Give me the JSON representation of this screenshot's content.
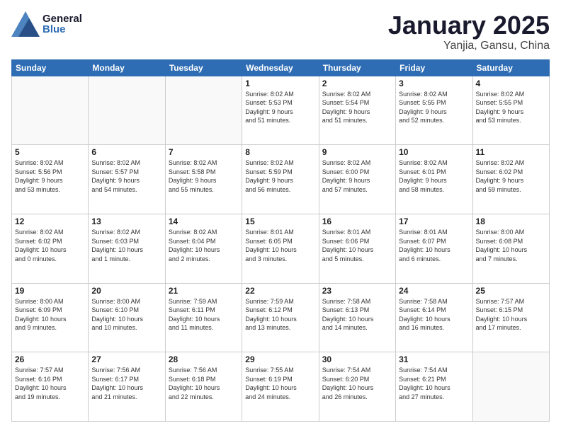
{
  "header": {
    "logo_general": "General",
    "logo_blue": "Blue",
    "title": "January 2025",
    "subtitle": "Yanjia, Gansu, China"
  },
  "days_of_week": [
    "Sunday",
    "Monday",
    "Tuesday",
    "Wednesday",
    "Thursday",
    "Friday",
    "Saturday"
  ],
  "weeks": [
    [
      {
        "day": "",
        "info": ""
      },
      {
        "day": "",
        "info": ""
      },
      {
        "day": "",
        "info": ""
      },
      {
        "day": "1",
        "info": "Sunrise: 8:02 AM\nSunset: 5:53 PM\nDaylight: 9 hours\nand 51 minutes."
      },
      {
        "day": "2",
        "info": "Sunrise: 8:02 AM\nSunset: 5:54 PM\nDaylight: 9 hours\nand 51 minutes."
      },
      {
        "day": "3",
        "info": "Sunrise: 8:02 AM\nSunset: 5:55 PM\nDaylight: 9 hours\nand 52 minutes."
      },
      {
        "day": "4",
        "info": "Sunrise: 8:02 AM\nSunset: 5:55 PM\nDaylight: 9 hours\nand 53 minutes."
      }
    ],
    [
      {
        "day": "5",
        "info": "Sunrise: 8:02 AM\nSunset: 5:56 PM\nDaylight: 9 hours\nand 53 minutes."
      },
      {
        "day": "6",
        "info": "Sunrise: 8:02 AM\nSunset: 5:57 PM\nDaylight: 9 hours\nand 54 minutes."
      },
      {
        "day": "7",
        "info": "Sunrise: 8:02 AM\nSunset: 5:58 PM\nDaylight: 9 hours\nand 55 minutes."
      },
      {
        "day": "8",
        "info": "Sunrise: 8:02 AM\nSunset: 5:59 PM\nDaylight: 9 hours\nand 56 minutes."
      },
      {
        "day": "9",
        "info": "Sunrise: 8:02 AM\nSunset: 6:00 PM\nDaylight: 9 hours\nand 57 minutes."
      },
      {
        "day": "10",
        "info": "Sunrise: 8:02 AM\nSunset: 6:01 PM\nDaylight: 9 hours\nand 58 minutes."
      },
      {
        "day": "11",
        "info": "Sunrise: 8:02 AM\nSunset: 6:02 PM\nDaylight: 9 hours\nand 59 minutes."
      }
    ],
    [
      {
        "day": "12",
        "info": "Sunrise: 8:02 AM\nSunset: 6:02 PM\nDaylight: 10 hours\nand 0 minutes."
      },
      {
        "day": "13",
        "info": "Sunrise: 8:02 AM\nSunset: 6:03 PM\nDaylight: 10 hours\nand 1 minute."
      },
      {
        "day": "14",
        "info": "Sunrise: 8:02 AM\nSunset: 6:04 PM\nDaylight: 10 hours\nand 2 minutes."
      },
      {
        "day": "15",
        "info": "Sunrise: 8:01 AM\nSunset: 6:05 PM\nDaylight: 10 hours\nand 3 minutes."
      },
      {
        "day": "16",
        "info": "Sunrise: 8:01 AM\nSunset: 6:06 PM\nDaylight: 10 hours\nand 5 minutes."
      },
      {
        "day": "17",
        "info": "Sunrise: 8:01 AM\nSunset: 6:07 PM\nDaylight: 10 hours\nand 6 minutes."
      },
      {
        "day": "18",
        "info": "Sunrise: 8:00 AM\nSunset: 6:08 PM\nDaylight: 10 hours\nand 7 minutes."
      }
    ],
    [
      {
        "day": "19",
        "info": "Sunrise: 8:00 AM\nSunset: 6:09 PM\nDaylight: 10 hours\nand 9 minutes."
      },
      {
        "day": "20",
        "info": "Sunrise: 8:00 AM\nSunset: 6:10 PM\nDaylight: 10 hours\nand 10 minutes."
      },
      {
        "day": "21",
        "info": "Sunrise: 7:59 AM\nSunset: 6:11 PM\nDaylight: 10 hours\nand 11 minutes."
      },
      {
        "day": "22",
        "info": "Sunrise: 7:59 AM\nSunset: 6:12 PM\nDaylight: 10 hours\nand 13 minutes."
      },
      {
        "day": "23",
        "info": "Sunrise: 7:58 AM\nSunset: 6:13 PM\nDaylight: 10 hours\nand 14 minutes."
      },
      {
        "day": "24",
        "info": "Sunrise: 7:58 AM\nSunset: 6:14 PM\nDaylight: 10 hours\nand 16 minutes."
      },
      {
        "day": "25",
        "info": "Sunrise: 7:57 AM\nSunset: 6:15 PM\nDaylight: 10 hours\nand 17 minutes."
      }
    ],
    [
      {
        "day": "26",
        "info": "Sunrise: 7:57 AM\nSunset: 6:16 PM\nDaylight: 10 hours\nand 19 minutes."
      },
      {
        "day": "27",
        "info": "Sunrise: 7:56 AM\nSunset: 6:17 PM\nDaylight: 10 hours\nand 21 minutes."
      },
      {
        "day": "28",
        "info": "Sunrise: 7:56 AM\nSunset: 6:18 PM\nDaylight: 10 hours\nand 22 minutes."
      },
      {
        "day": "29",
        "info": "Sunrise: 7:55 AM\nSunset: 6:19 PM\nDaylight: 10 hours\nand 24 minutes."
      },
      {
        "day": "30",
        "info": "Sunrise: 7:54 AM\nSunset: 6:20 PM\nDaylight: 10 hours\nand 26 minutes."
      },
      {
        "day": "31",
        "info": "Sunrise: 7:54 AM\nSunset: 6:21 PM\nDaylight: 10 hours\nand 27 minutes."
      },
      {
        "day": "",
        "info": ""
      }
    ]
  ]
}
